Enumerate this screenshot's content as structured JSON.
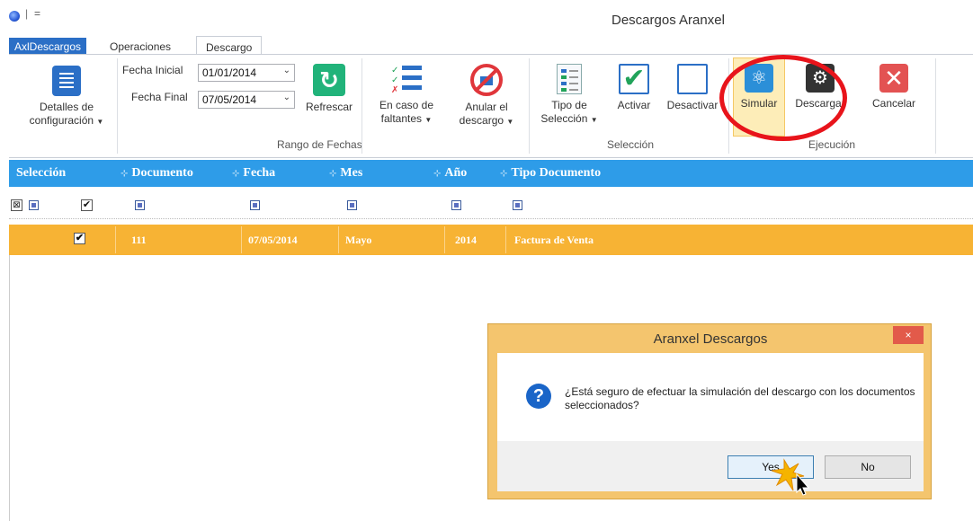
{
  "window": {
    "title": "Descargos Aranxel",
    "qa_arrow": "="
  },
  "tabs": {
    "file": "AxlDescargos",
    "operaciones": "Operaciones",
    "descargo": "Descargo"
  },
  "ribbon": {
    "detalles": {
      "line1": "Detalles de",
      "line2": "configuración"
    },
    "fecha_inicial": {
      "label": "Fecha Inicial",
      "value": "01/01/2014"
    },
    "fecha_final": {
      "label": "Fecha Final",
      "value": "07/05/2014"
    },
    "refrescar": "Refrescar",
    "faltantes": {
      "line1": "En caso de",
      "line2": "faltantes"
    },
    "anular": {
      "line1": "Anular el",
      "line2": "descargo"
    },
    "group_rango": "Rango de Fechas",
    "tipo_seleccion": {
      "line1": "Tipo de",
      "line2": "Selección"
    },
    "activar": "Activar",
    "desactivar": "Desactivar",
    "group_seleccion": "Selección",
    "simular": "Simular",
    "descargar": "Descargar",
    "cancelar": "Cancelar",
    "group_ejecucion": "Ejecución"
  },
  "grid": {
    "headers": {
      "seleccion": "Selección",
      "documento": "Documento",
      "fecha": "Fecha",
      "mes": "Mes",
      "anio": "Año",
      "tipo": "Tipo Documento"
    },
    "row": {
      "checked": "✔",
      "documento": "111",
      "fecha": "07/05/2014",
      "mes": "Mayo",
      "anio": "2014",
      "tipo": "Factura de Venta"
    }
  },
  "dialog": {
    "title": "Aranxel Descargos",
    "close": "×",
    "message": "¿Está seguro de efectuar la simulación del descargo con los documentos seleccionados?",
    "yes": "Yes",
    "no": "No"
  },
  "colors": {
    "accent": "#2b6fc6",
    "grid_header": "#2e9ce8",
    "selected_row": "#f7b334",
    "dialog_frame": "#f4c56e",
    "highlight_ring": "#e8141b"
  }
}
